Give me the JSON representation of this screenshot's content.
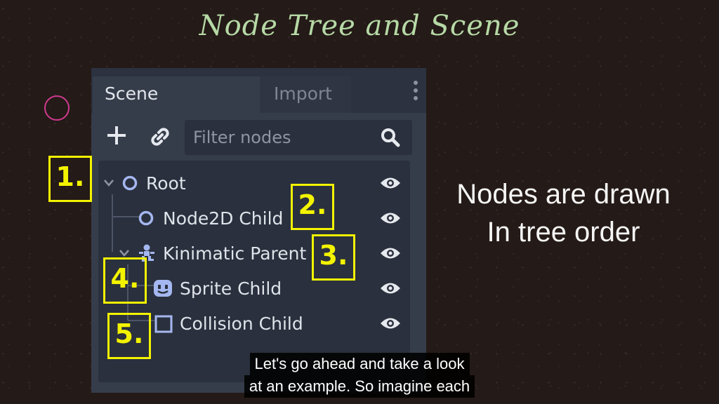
{
  "title": "Node Tree and Scene",
  "panel": {
    "tabs": [
      {
        "label": "Scene",
        "active": true
      },
      {
        "label": "Import",
        "active": false
      }
    ],
    "toolbar": {
      "add_icon": "plus-icon",
      "link_icon": "link-icon",
      "filter_placeholder": "Filter nodes",
      "search_icon": "search-icon"
    },
    "tree": [
      {
        "label": "Root",
        "icon": "node-circle-icon",
        "collapse": "chevron-down-icon",
        "visible": true
      },
      {
        "label": "Node2D Child",
        "icon": "node2d-circle-icon",
        "visible": true
      },
      {
        "label": "Kinimatic Parent",
        "icon": "kinematic-body-icon",
        "collapse": "chevron-down-icon",
        "visible": true
      },
      {
        "label": "Sprite Child",
        "icon": "sprite-face-icon",
        "visible": true
      },
      {
        "label": "Collision Child",
        "icon": "collision-square-icon",
        "visible": true
      }
    ]
  },
  "annotations": [
    "1.",
    "2.",
    "3.",
    "4.",
    "5."
  ],
  "side_text": [
    "Nodes are drawn",
    "In tree order"
  ],
  "caption": [
    "Let's go ahead and take a look",
    "at an example. So imagine each"
  ],
  "colors": {
    "background": "#241a17",
    "title": "#b6d9a6",
    "panel": "#363d4a",
    "tree_bg": "#2a303d",
    "node_icon": "#a5b7f0",
    "annotation": "#f3f300",
    "circle_marker": "#d03a8f"
  }
}
